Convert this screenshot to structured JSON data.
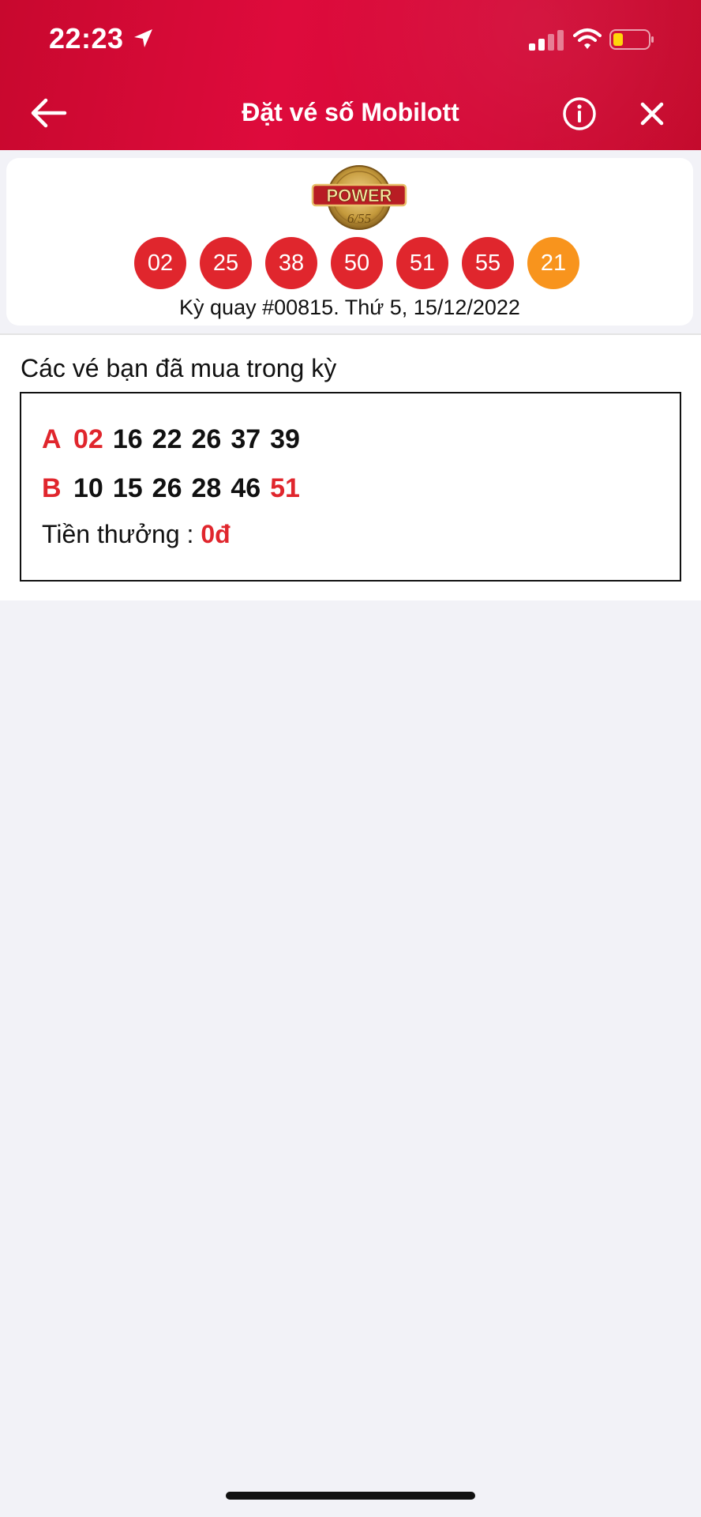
{
  "status_bar": {
    "time": "22:23"
  },
  "header": {
    "title": "Đặt vé số Mobilott"
  },
  "draw": {
    "logo_text": "POWER",
    "logo_subtext": "6/55",
    "numbers": [
      "02",
      "25",
      "38",
      "50",
      "51",
      "55"
    ],
    "bonus": "21",
    "info": "Kỳ quay #00815. Thứ 5, 15/12/2022"
  },
  "tickets": {
    "title": "Các vé bạn đã mua trong kỳ",
    "rows": [
      {
        "letter": "A",
        "numbers": [
          "02",
          "16",
          "22",
          "26",
          "37",
          "39"
        ],
        "hits": [
          true,
          false,
          false,
          false,
          false,
          false
        ]
      },
      {
        "letter": "B",
        "numbers": [
          "10",
          "15",
          "26",
          "28",
          "46",
          "51"
        ],
        "hits": [
          false,
          false,
          false,
          false,
          false,
          true
        ]
      }
    ],
    "prize_label": "Tiền thưởng : ",
    "prize_value": "0đ"
  },
  "colors": {
    "header_red": "#d40836",
    "ball_red": "#e0262d",
    "bonus_orange": "#f8941d"
  }
}
